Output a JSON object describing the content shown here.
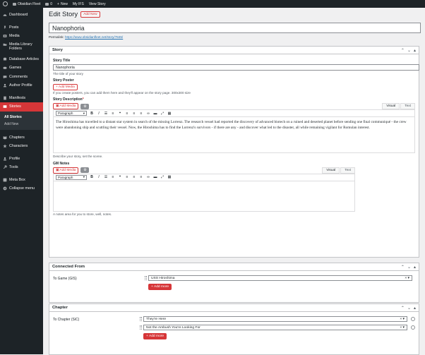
{
  "adminbar": {
    "site_name": "Obsidian Fleet",
    "comments_count": "0",
    "new_label": "New",
    "my_profile": "My IFS",
    "view_story": "View Story"
  },
  "sidebar": {
    "items": [
      {
        "label": "Dashboard",
        "icon": "dashboard-icon"
      },
      {
        "label": "Posts",
        "icon": "pin-icon"
      },
      {
        "label": "Media",
        "icon": "media-icon"
      },
      {
        "label": "Media Library Folders",
        "icon": "folder-icon"
      },
      {
        "label": "Database Articles",
        "icon": "database-icon"
      },
      {
        "label": "Games",
        "icon": "games-icon"
      },
      {
        "label": "Comments",
        "icon": "comment-icon"
      },
      {
        "label": "Author Profile",
        "icon": "user-icon"
      },
      {
        "label": "Manifests",
        "icon": "manifest-icon"
      },
      {
        "label": "Stories",
        "icon": "stories-icon"
      },
      {
        "label": "Chapters",
        "icon": "chapters-icon"
      },
      {
        "label": "Characters",
        "icon": "star-icon"
      },
      {
        "label": "Profile",
        "icon": "profile-icon"
      },
      {
        "label": "Tools",
        "icon": "wrench-icon"
      },
      {
        "label": "Meta Box",
        "icon": "metabox-icon"
      },
      {
        "label": "Collapse menu",
        "icon": "collapse-icon"
      }
    ],
    "submenu": [
      "All Stories",
      "Add New"
    ]
  },
  "page": {
    "title": "Edit Story",
    "add_new": "Add New",
    "post_title": "Nanophoria",
    "permalink_label": "Permalink:",
    "permalink_url": "https://www.obsidianfleet.net/story/7845/"
  },
  "story_box": {
    "heading": "Story",
    "story_title_label": "Story Title",
    "story_title_value": "Nanophoria",
    "story_title_hint": "The title of your story",
    "poster_label": "Story Poster",
    "add_media": "+ Add Media",
    "poster_hint": "If you create posters, you can add them here and they'll appear on the story page. 300x300 size",
    "description_label": "Story Description",
    "required_mark": "*",
    "add_media_btn": "Add Media",
    "visual_tab": "Visual",
    "text_tab": "Text",
    "format_select": "Paragraph",
    "description_text": "The Hiroshima has travelled to a distant star system in search of the missing Lorrenz. The research vessel had reported the discovery of advanced biotech on a ruined and deserted planet before sending one final communiqué - the crew were abandoning ship and scuttling their vessel. Now, the Hiroshima has to find the Lorrenz's survivors - if there are any - and discover what led to the disaster, all while remaining vigilant for Romulan interest.",
    "description_hint": "Describe your story, set the scene.",
    "gm_notes_label": "GM Notes",
    "gm_notes_hint": "A notes area for you to store, well, notes."
  },
  "connected_box": {
    "heading": "Connected From",
    "field_label": "To Game (GIS)",
    "selected": "USS Hiroshima",
    "add_more": "+ Add more"
  },
  "chapter_box": {
    "heading": "Chapter",
    "field_label": "To Chapter (SiC)",
    "items": [
      "They're Here",
      "Not the Ambush You're Looking For"
    ],
    "add_more": "+ Add more"
  },
  "colors": {
    "accent": "#d63638",
    "admin_dark": "#1d2327"
  }
}
